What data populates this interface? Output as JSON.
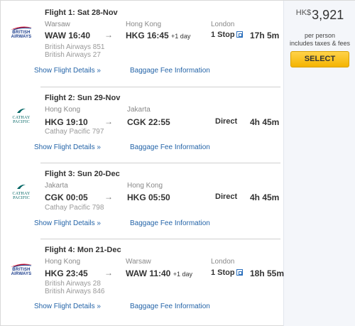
{
  "price": {
    "currency": "HK$",
    "amount": "3,921",
    "note_line1": "per person",
    "note_line2": "includes taxes & fees",
    "select_label": "SELECT"
  },
  "links": {
    "show_details": "Show Flight Details",
    "baggage": "Baggage Fee Information"
  },
  "arrow_glyph": "→",
  "flights": [
    {
      "title": "Flight 1:  Sat 28-Nov",
      "airline_logo": "british-airways-logo",
      "logo_text_1": "BRITISH",
      "logo_text_2": "AIRWAYS",
      "from_city": "Warsaw",
      "from": "WAW  16:40",
      "to_city": "Hong Kong",
      "to": "HKG  16:45",
      "to_day": "+1 day",
      "via_city": "London",
      "stops": "1 Stop",
      "duration": "17h 5m",
      "airline_1": "British Airways 851",
      "airline_2": "British Airways 27"
    },
    {
      "title": "Flight 2:  Sun 29-Nov",
      "airline_logo": "cathay-pacific-logo",
      "logo_text_1": "CATHAY PACIFIC",
      "from_city": "Hong Kong",
      "from": "HKG  19:10",
      "to_city": "Jakarta",
      "to": "CGK  22:55",
      "stops": "Direct",
      "duration": "4h 45m",
      "airline_1": "Cathay Pacific 797"
    },
    {
      "title": "Flight 3:  Sun 20-Dec",
      "airline_logo": "cathay-pacific-logo",
      "logo_text_1": "CATHAY PACIFIC",
      "from_city": "Jakarta",
      "from": "CGK  00:05",
      "to_city": "Hong Kong",
      "to": "HKG  05:50",
      "stops": "Direct",
      "duration": "4h 45m",
      "airline_1": "Cathay Pacific 798"
    },
    {
      "title": "Flight 4:  Mon 21-Dec",
      "airline_logo": "british-airways-logo",
      "logo_text_1": "BRITISH",
      "logo_text_2": "AIRWAYS",
      "from_city": "Hong Kong",
      "from": "HKG  23:45",
      "to_city": "Warsaw",
      "to": "WAW  11:40",
      "to_day": "+1 day",
      "via_city": "London",
      "stops": "1 Stop",
      "duration": "18h 55m",
      "airline_1": "British Airways 28",
      "airline_2": "British Airways 846"
    }
  ]
}
